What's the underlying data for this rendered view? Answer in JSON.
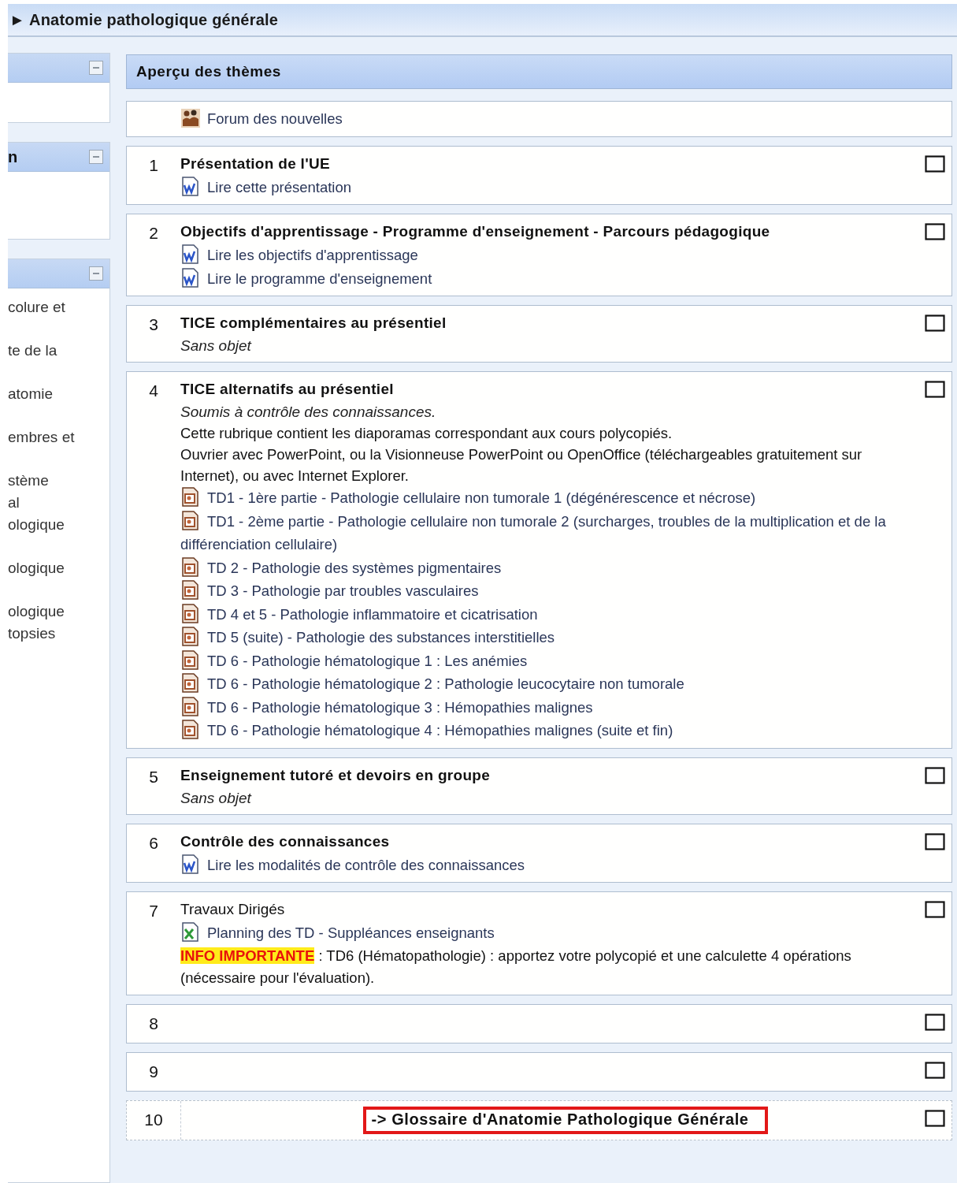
{
  "header": {
    "marker": "►",
    "title": "Anatomie pathologique générale"
  },
  "sidebar": {
    "blocks": [
      {
        "collapsible": true
      },
      {
        "title": "n",
        "collapsible": true
      },
      {
        "collapsible": true,
        "items": [
          {
            "lines": [
              "colure et"
            ]
          },
          {
            "lines": [
              "te de la"
            ]
          },
          {
            "lines": [
              "atomie"
            ]
          },
          {
            "lines": [
              "embres et"
            ]
          },
          {
            "lines": [
              "stème",
              "al",
              "ologique"
            ]
          },
          {
            "lines": [
              "ologique"
            ]
          },
          {
            "lines": [
              "ologique",
              "topsies"
            ]
          }
        ]
      }
    ]
  },
  "overview": {
    "title": "Aperçu des thèmes"
  },
  "news": {
    "label": "Forum des nouvelles"
  },
  "topics": [
    {
      "number": "1",
      "hidden": false,
      "title": "Présentation de l'UE",
      "title_bold": true,
      "entries": [
        {
          "kind": "document",
          "text": "Lire cette présentation"
        }
      ]
    },
    {
      "number": "2",
      "hidden": false,
      "title": "Objectifs d'apprentissage - Programme d'enseignement - Parcours pédagogique",
      "title_bold": true,
      "entries": [
        {
          "kind": "document",
          "text": "Lire les objectifs d'apprentissage"
        },
        {
          "kind": "document",
          "text": "Lire le programme d'enseignement"
        }
      ]
    },
    {
      "number": "3",
      "hidden": false,
      "title": "TICE complémentaires au présentiel",
      "title_bold": true,
      "entries": [
        {
          "kind": "note",
          "text": "Sans objet"
        }
      ]
    },
    {
      "number": "4",
      "hidden": false,
      "title": "TICE alternatifs au présentiel",
      "title_bold": true,
      "entries": [
        {
          "kind": "note",
          "text": "Soumis à contrôle des connaissances."
        },
        {
          "kind": "text",
          "text": "Cette rubrique contient les diaporamas correspondant aux cours polycopiés."
        },
        {
          "kind": "text",
          "text": "Ouvrier avec PowerPoint, ou la Visionneuse PowerPoint ou OpenOffice (téléchargeables gratuitement sur Internet), ou avec Internet Explorer."
        },
        {
          "kind": "slides",
          "text": "TD1 - 1ère partie - Pathologie cellulaire non tumorale 1 (dégénérescence et nécrose)"
        },
        {
          "kind": "slides",
          "text": "TD1 - 2ème partie - Pathologie cellulaire non tumorale 2 (surcharges, troubles de la multiplication et de la différenciation cellulaire)"
        },
        {
          "kind": "slides",
          "text": "TD 2 - Pathologie des systèmes pigmentaires"
        },
        {
          "kind": "slides",
          "text": "TD 3 - Pathologie par troubles vasculaires"
        },
        {
          "kind": "slides",
          "text": "TD 4 et 5 - Pathologie inflammatoire et cicatrisation"
        },
        {
          "kind": "slides",
          "text": "TD 5 (suite) - Pathologie des substances interstitielles"
        },
        {
          "kind": "slides",
          "text": "TD 6 - Pathologie hématologique 1 : Les anémies"
        },
        {
          "kind": "slides",
          "text": "TD 6 - Pathologie hématologique 2 : Pathologie leucocytaire non tumorale"
        },
        {
          "kind": "slides",
          "text": "TD 6 - Pathologie hématologique 3 : Hémopathies malignes"
        },
        {
          "kind": "slides",
          "text": "TD 6 - Pathologie hématologique 4 : Hémopathies malignes (suite et fin)"
        }
      ]
    },
    {
      "number": "5",
      "hidden": false,
      "title": "Enseignement tutoré et devoirs en groupe",
      "title_bold": true,
      "entries": [
        {
          "kind": "note",
          "text": "Sans objet"
        }
      ]
    },
    {
      "number": "6",
      "hidden": false,
      "title": "Contrôle des connaissances",
      "title_bold": true,
      "entries": [
        {
          "kind": "document",
          "text": "Lire les modalités de contrôle des connaissances"
        }
      ]
    },
    {
      "number": "7",
      "hidden": false,
      "title": "Travaux Dirigés",
      "title_bold": false,
      "entries": [
        {
          "kind": "sheet",
          "text": "Planning des TD - Suppléances enseignants"
        },
        {
          "kind": "alert",
          "highlight": "INFO IMPORTANTE",
          "text": " : TD6 (Hématopathologie) : apportez votre polycopié et une calculette 4 opérations (nécessaire pour l'évaluation)."
        }
      ]
    },
    {
      "number": "8",
      "hidden": false
    },
    {
      "number": "9",
      "hidden": false
    },
    {
      "number": "10",
      "hidden": true,
      "entries": [
        {
          "kind": "boxed",
          "text": "-> Glossaire d'Anatomie Pathologique Générale"
        }
      ]
    }
  ]
}
